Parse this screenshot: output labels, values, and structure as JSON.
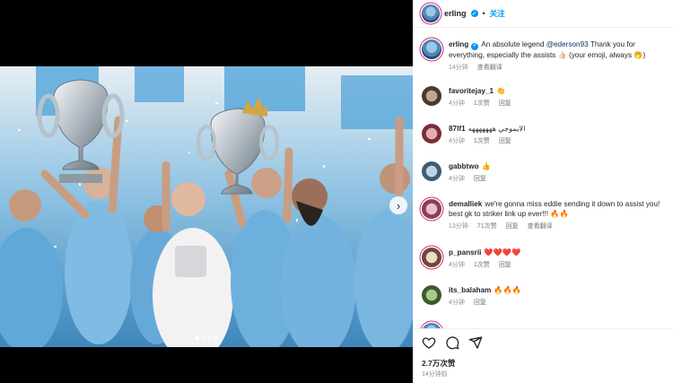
{
  "post_author": {
    "username": "erling",
    "follow_label": "关注",
    "separator": "•"
  },
  "caption": {
    "username": "erling",
    "text_before": "An absolute legend ",
    "mention": "@ederson93",
    "text_after": " Thank you for everything, especially the assists 👍🏻 (your emoji, always 🤭)",
    "time": "14分钟",
    "translate": "查看翻译"
  },
  "comments": [
    {
      "username": "favoritejay_1",
      "text": "👏",
      "time": "4分钟",
      "likes": "1次赞",
      "reply": "回复"
    },
    {
      "username": "87lf1",
      "text": "الايموجي هههههههه",
      "time": "4分钟",
      "likes": "1次赞",
      "reply": "回复"
    },
    {
      "username": "gabbtwo",
      "text": "👍",
      "time": "4分钟",
      "likes": "",
      "reply": "回复"
    },
    {
      "username": "demalliek",
      "text": "we're gonna miss eddie sending it down to assist you! best gk to striker link up ever!!! 🔥🔥",
      "time": "13分钟",
      "likes": "71次赞",
      "reply": "回复",
      "translate": "查看翻译"
    },
    {
      "username": "p_pansrii",
      "text": "❤️❤️❤️❤️",
      "time": "4分钟",
      "likes": "1次赞",
      "reply": "回复"
    },
    {
      "username": "its_balaham",
      "text": "🔥🔥🔥",
      "time": "4分钟",
      "likes": "",
      "reply": "回复"
    }
  ],
  "likes_count": "2.7万次赞",
  "post_time": "14分钟前",
  "colors": {
    "accent": "#0095f6",
    "sky_blue": "#6fb6e0",
    "story_ring": "#d62976"
  },
  "icons": [
    "verified-badge-icon",
    "heart-icon",
    "comment-icon",
    "share-icon",
    "chevron-right-icon"
  ]
}
